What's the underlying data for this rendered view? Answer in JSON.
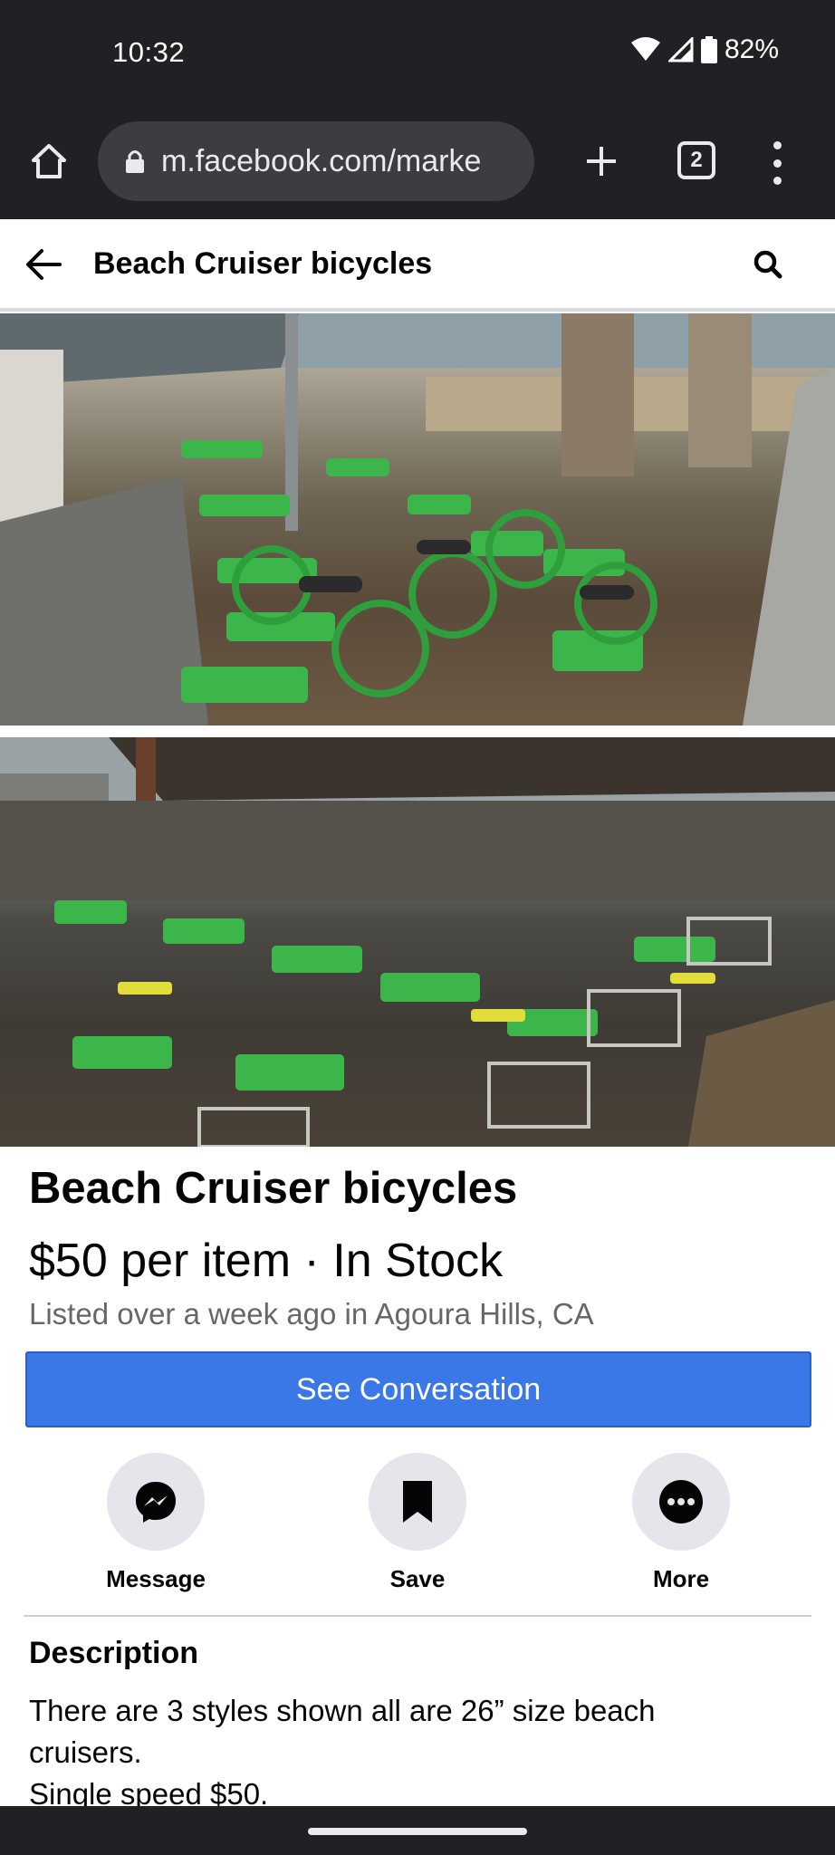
{
  "status_bar": {
    "time": "10:32",
    "battery": "82%"
  },
  "browser": {
    "url": "m.facebook.com/marke",
    "tab_count": "2"
  },
  "header": {
    "title": "Beach Cruiser bicycles"
  },
  "listing": {
    "title": "Beach Cruiser bicycles",
    "price": "$50 per item · In Stock",
    "meta": "Listed over a week ago in Agoura Hills, CA",
    "cta": "See Conversation"
  },
  "actions": {
    "message": "Message",
    "save": "Save",
    "more": "More"
  },
  "description": {
    "heading": "Description",
    "line1": "There are 3 styles shown all are 26” size beach",
    "line2": "cruisers.",
    "line3": "Single speed $50."
  },
  "colors": {
    "accent_button": "#3b78e7",
    "system_bar": "#202124",
    "bike_green": "#3cb54a"
  }
}
